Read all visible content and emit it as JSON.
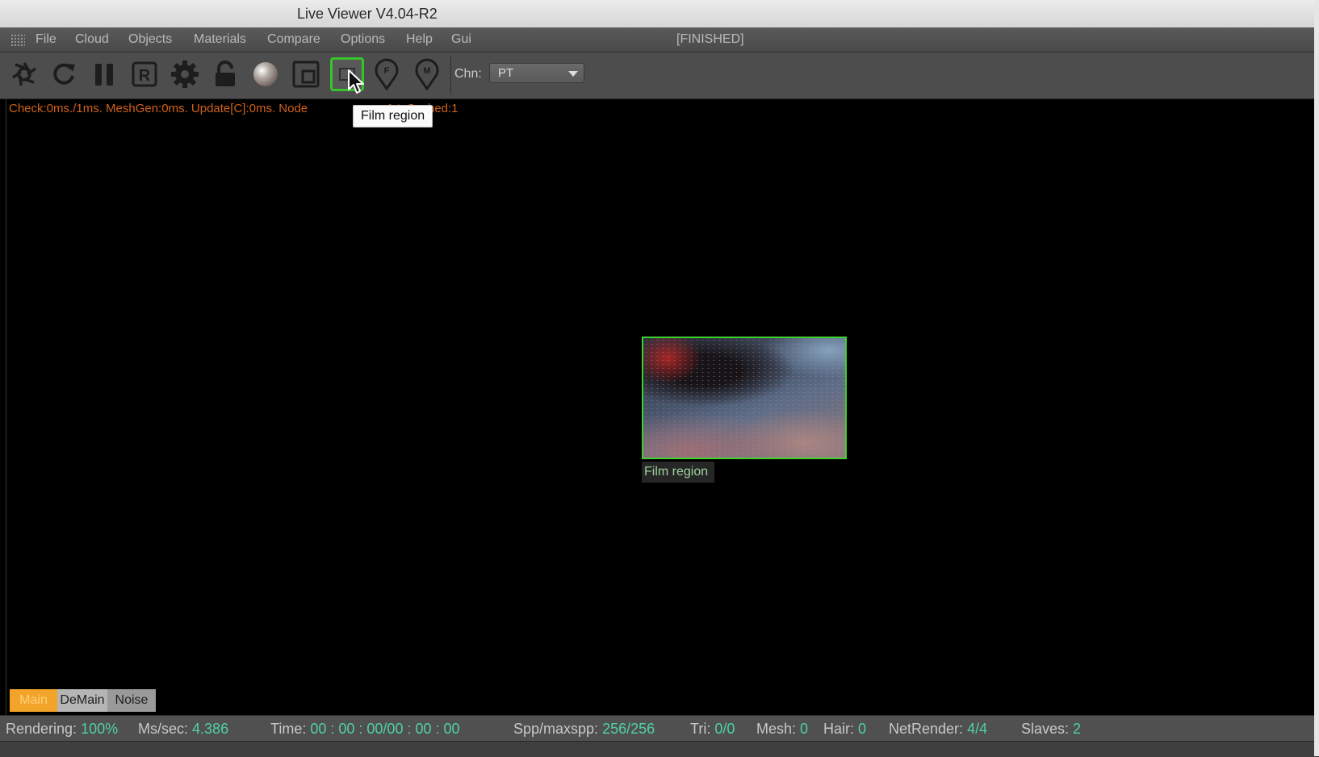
{
  "window": {
    "title": "Live Viewer V4.04-R2"
  },
  "menu": {
    "items": [
      "File",
      "Cloud",
      "Objects",
      "Materials",
      "Compare",
      "Options",
      "Help",
      "Gui"
    ],
    "status": "[FINISHED]"
  },
  "toolbar": {
    "buttons": [
      {
        "icon": "aperture-icon"
      },
      {
        "icon": "refresh-icon"
      },
      {
        "icon": "pause-icon"
      },
      {
        "icon": "r-letter-icon",
        "letter": "R"
      },
      {
        "icon": "gear-icon"
      },
      {
        "icon": "lock-icon"
      },
      {
        "icon": "sphere-icon"
      },
      {
        "icon": "region-icon"
      },
      {
        "icon": "film-region-icon",
        "active": true
      },
      {
        "icon": "focus-pin-icon",
        "letter": "F"
      },
      {
        "icon": "material-pin-icon",
        "letter": "M"
      }
    ],
    "channel_label": "Chn:",
    "channel_value": "PT"
  },
  "viewport": {
    "stats_line_left": "Check:0ms./1ms. MeshGen:0ms. Update[C]:0ms. Node",
    "stats_line_right": "1 txCached:1",
    "tooltip": "Film region",
    "film_label": "Film region"
  },
  "passes": [
    "Main",
    "DeMain",
    "Noise"
  ],
  "status": [
    {
      "label": "Rendering:",
      "value": "100%"
    },
    {
      "label": "Ms/sec:",
      "value": "4.386"
    },
    {
      "label": "Time:",
      "value": "00 : 00 : 00/00 : 00 : 00"
    },
    {
      "label": "Spp/maxspp:",
      "value": "256/256"
    },
    {
      "label": "Tri:",
      "value": "0/0"
    },
    {
      "label": "Mesh:",
      "value": "0"
    },
    {
      "label": "Hair:",
      "value": "0"
    },
    {
      "label": "NetRender:",
      "value": "4/4"
    },
    {
      "label": "Slaves:",
      "value": "2"
    }
  ],
  "colors": {
    "stats_text": "#d0611a",
    "status_value": "#4fd0a8",
    "active_outline": "#35c52a",
    "main_tab": "#f2a42a"
  }
}
